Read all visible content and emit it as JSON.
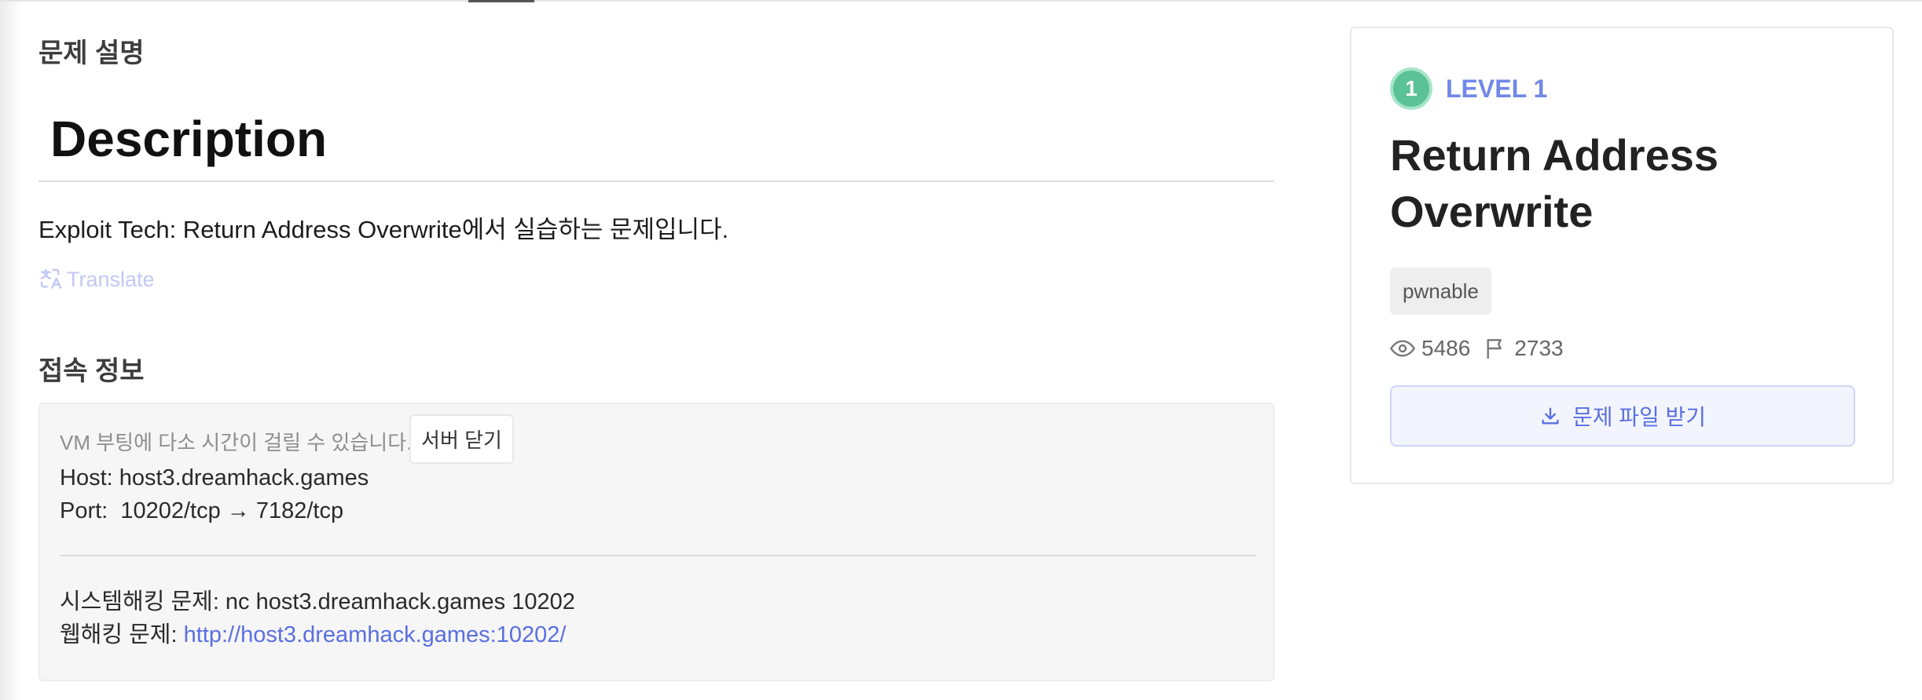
{
  "description_section": {
    "title": "문제 설명",
    "heading": "Description",
    "text": "Exploit Tech: Return Address Overwrite에서 실습하는 문제입니다.",
    "translate_label": "Translate"
  },
  "connection_section": {
    "title": "접속 정보",
    "vm_note": "VM 부팅에 다소 시간이 걸릴 수 있습니다.",
    "close_server_label": "서버 닫기",
    "host_line": "Host: host3.dreamhack.games",
    "port_line": "Port:  10202/tcp → 7182/tcp",
    "system_line": "시스템해킹 문제: nc host3.dreamhack.games 10202",
    "web_label": "웹해킹 문제: ",
    "web_url": "http://host3.dreamhack.games:10202/"
  },
  "challenge_card": {
    "level_number": "1",
    "level_label": "LEVEL 1",
    "title": "Return Address Overwrite",
    "tag": "pwnable",
    "views": "5486",
    "solves": "2733",
    "download_label": "문제 파일 받기",
    "icons": [
      "eye-icon",
      "flag-icon",
      "download-icon"
    ],
    "colors": {
      "accent": "#5a6fe0",
      "level_badge": "#5bc298"
    }
  }
}
